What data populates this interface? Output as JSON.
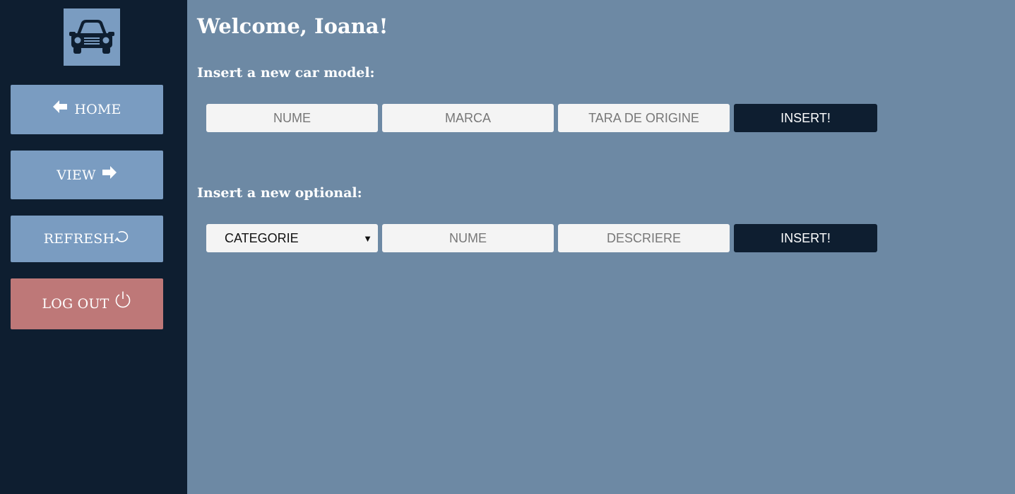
{
  "sidebar": {
    "logo_icon": "car-icon",
    "items": [
      {
        "label": "HOME",
        "icon": "arrow-left-icon"
      },
      {
        "label": "VIEW",
        "icon": "arrow-right-icon"
      },
      {
        "label": "REFRESH",
        "icon": "refresh-icon"
      },
      {
        "label": "LOG OUT",
        "icon": "power-icon"
      }
    ]
  },
  "main": {
    "welcome": "Welcome, Ioana!",
    "car_model": {
      "title": "Insert a new car model:",
      "name_placeholder": "NUME",
      "brand_placeholder": "MARCA",
      "country_placeholder": "TARA DE ORIGINE",
      "submit_label": "INSERT!"
    },
    "optional": {
      "title": "Insert a new optional:",
      "category_selected": "CATEGORIE",
      "name_placeholder": "NUME",
      "description_placeholder": "DESCRIERE",
      "submit_label": "INSERT!"
    }
  },
  "colors": {
    "sidebar_bg": "#0e1e30",
    "main_bg": "#6d89a4",
    "nav_button": "#7a9cc1",
    "logout_button": "#be7878",
    "insert_button": "#0e1e30",
    "field_bg": "#f4f4f4"
  }
}
